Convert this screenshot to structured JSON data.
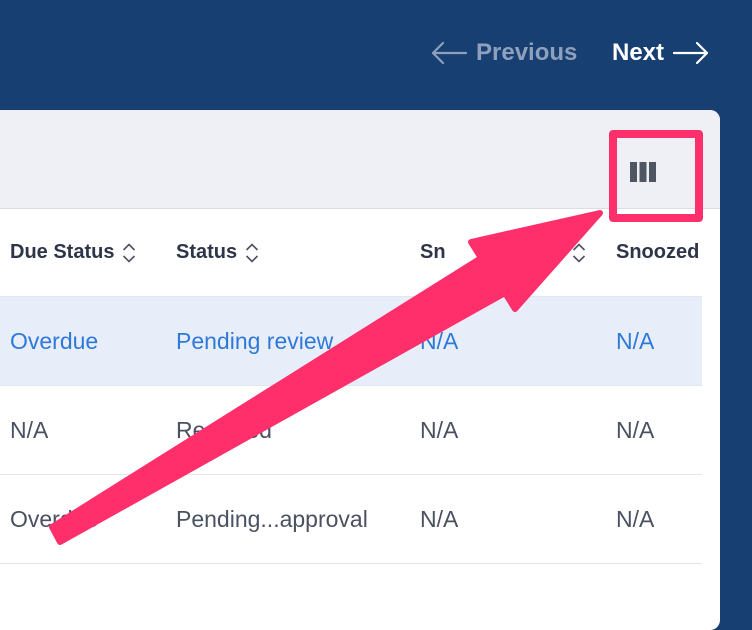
{
  "pagination": {
    "previous_label": "Previous",
    "next_label": "Next"
  },
  "table": {
    "columns": [
      {
        "label": "Due Status"
      },
      {
        "label": "Status"
      },
      {
        "label": "Sn"
      },
      {
        "label": "Snoozed"
      }
    ],
    "rows": [
      {
        "due_status": "Overdue",
        "status": "Pending review",
        "col3": "N/A",
        "snoozed": "N/A",
        "highlighted": true
      },
      {
        "due_status": "N/A",
        "status": "Resolved",
        "col3": "N/A",
        "snoozed": "N/A"
      },
      {
        "due_status": "Overdue",
        "status": "Pending...approval",
        "col3": "N/A",
        "snoozed": "N/A"
      }
    ]
  },
  "colors": {
    "header_bg": "#173f72",
    "link_blue": "#2e79d8",
    "annotation_pink": "#ff2f6b"
  },
  "icons": {
    "columns_toggle": "columns-icon",
    "sort": "sort-chevrons-icon"
  }
}
